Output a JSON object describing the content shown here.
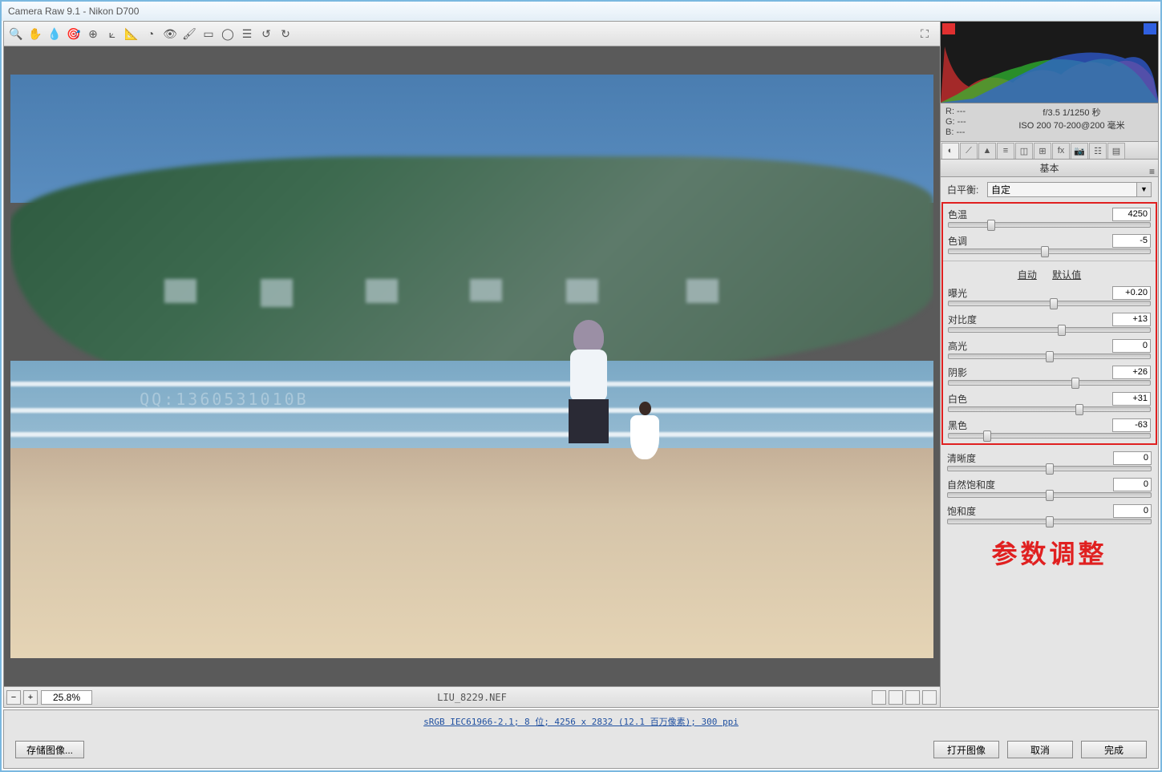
{
  "title": "Camera Raw 9.1  -  Nikon D700",
  "zoom": {
    "value": "25.8%"
  },
  "filename": "LIU_8229.NEF",
  "info": {
    "r": "R:  ---",
    "g": "G:  ---",
    "b": "B:  ---",
    "aperture_shutter": "f/3.5  1/1250 秒",
    "iso_lens": "ISO 200  70-200@200 毫米"
  },
  "basic_panel": {
    "title": "基本",
    "wb_label": "白平衡:",
    "wb_value": "自定",
    "auto": "自动",
    "default": "默认值",
    "sliders": {
      "temp": {
        "label": "色温",
        "value": "4250",
        "pos": 21
      },
      "tint": {
        "label": "色调",
        "value": "-5",
        "pos": 48
      },
      "exposure": {
        "label": "曝光",
        "value": "+0.20",
        "pos": 52
      },
      "contrast": {
        "label": "对比度",
        "value": "+13",
        "pos": 56
      },
      "highlights": {
        "label": "高光",
        "value": "0",
        "pos": 50
      },
      "shadows": {
        "label": "阴影",
        "value": "+26",
        "pos": 63
      },
      "whites": {
        "label": "白色",
        "value": "+31",
        "pos": 65
      },
      "blacks": {
        "label": "黑色",
        "value": "-63",
        "pos": 19
      },
      "clarity": {
        "label": "清晰度",
        "value": "0",
        "pos": 50
      },
      "vibrance": {
        "label": "自然饱和度",
        "value": "0",
        "pos": 50
      },
      "saturation": {
        "label": "饱和度",
        "value": "0",
        "pos": 50
      }
    }
  },
  "annotation": "参数调整",
  "profile": "sRGB IEC61966-2.1; 8 位; 4256 x 2832 (12.1 百万像素); 300 ppi",
  "footer": {
    "save": "存储图像...",
    "open": "打开图像",
    "cancel": "取消",
    "done": "完成"
  }
}
